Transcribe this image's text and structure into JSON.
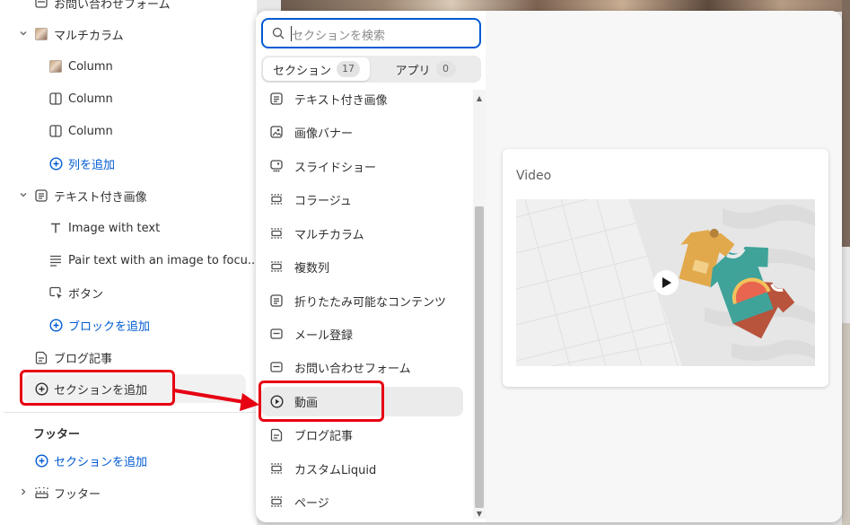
{
  "sidebar": {
    "rows": [
      {
        "label": "お問い合わせフォーム",
        "icon": "mail-icon"
      },
      {
        "label": "マルチカラム",
        "icon": "image-thumb-icon"
      },
      {
        "label": "Column",
        "icon": "image-thumb-icon"
      },
      {
        "label": "Column",
        "icon": "column-icon"
      },
      {
        "label": "Column",
        "icon": "column-icon"
      },
      {
        "label": "列を追加",
        "icon": "plus-circle-icon"
      },
      {
        "label": "テキスト付き画像",
        "icon": "text-image-icon"
      },
      {
        "label": "Image with text",
        "icon": "text-type-icon"
      },
      {
        "label": "Pair text with an image to focu...",
        "icon": "paragraph-icon"
      },
      {
        "label": "ボタン",
        "icon": "button-icon"
      },
      {
        "label": "ブロックを追加",
        "icon": "plus-circle-icon"
      },
      {
        "label": "ブログ記事",
        "icon": "blog-icon"
      },
      {
        "label": "セクションを追加",
        "icon": "plus-circle-icon"
      }
    ],
    "footer_heading": "フッター",
    "footer_add": "セクションを追加",
    "footer_item": "フッター"
  },
  "picker": {
    "search_placeholder": "セクションを検索",
    "tabs": [
      {
        "label": "セクション",
        "count": "17"
      },
      {
        "label": "アプリ",
        "count": "0"
      }
    ],
    "items": [
      {
        "label": "テキスト付き画像",
        "icon": "text-image-icon"
      },
      {
        "label": "画像バナー",
        "icon": "image-banner-icon"
      },
      {
        "label": "スライドショー",
        "icon": "slideshow-icon"
      },
      {
        "label": "コラージュ",
        "icon": "collage-icon"
      },
      {
        "label": "マルチカラム",
        "icon": "multicolumn-icon"
      },
      {
        "label": "複数列",
        "icon": "multirow-icon"
      },
      {
        "label": "折りたたみ可能なコンテンツ",
        "icon": "collapsible-icon"
      },
      {
        "label": "メール登録",
        "icon": "email-signup-icon"
      },
      {
        "label": "お問い合わせフォーム",
        "icon": "contact-form-icon"
      },
      {
        "label": "動画",
        "icon": "video-icon"
      },
      {
        "label": "ブログ記事",
        "icon": "blog-icon"
      },
      {
        "label": "カスタムLiquid",
        "icon": "liquid-icon"
      },
      {
        "label": "ページ",
        "icon": "page-icon"
      }
    ]
  },
  "preview": {
    "title": "Video"
  },
  "colors": {
    "accent": "#005bd3",
    "annotation": "#e60012"
  }
}
